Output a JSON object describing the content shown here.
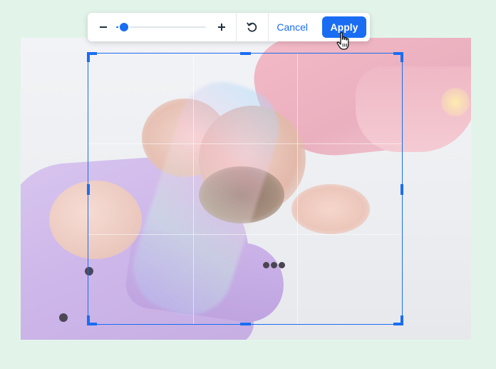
{
  "toolbar": {
    "zoom_out_icon": "minus-icon",
    "zoom_in_icon": "plus-icon",
    "zoom_level_fraction": 0.09,
    "reset_icon": "rotate-ccw-icon",
    "cancel_label": "Cancel",
    "apply_label": "Apply",
    "accent_color": "#1a6df2"
  },
  "canvas": {
    "background_color": "#e2f4ea",
    "crop_frame_color": "#1a6df2",
    "grid": "rule-of-thirds"
  },
  "cursor": {
    "icon": "hand-pointer-icon"
  }
}
